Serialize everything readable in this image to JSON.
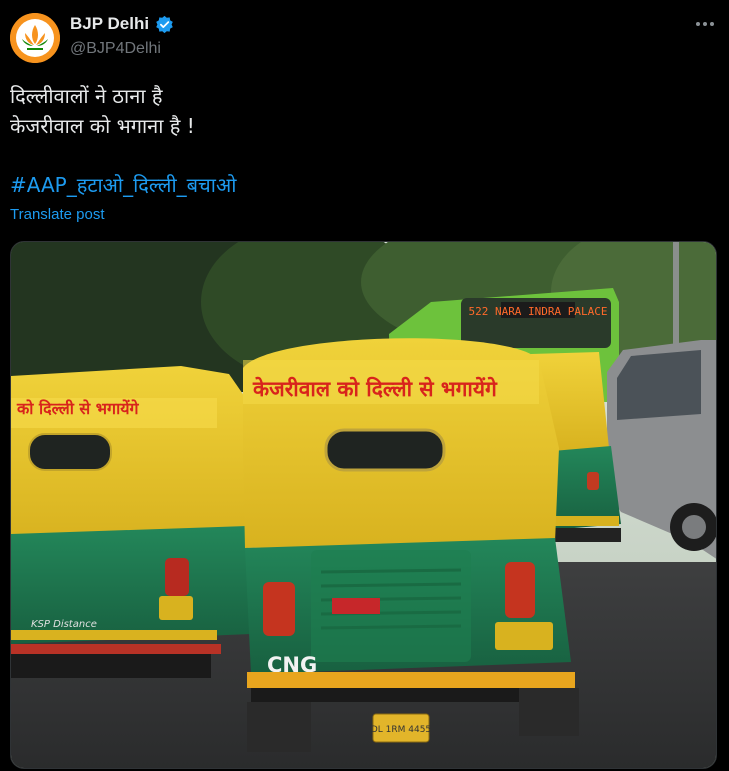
{
  "account": {
    "display_name": "BJP Delhi",
    "handle": "@BJP4Delhi",
    "verified": true,
    "avatar_icon": "lotus-logo-icon",
    "avatar_color": "#f7931e"
  },
  "post": {
    "lines": [
      "दिल्लीवालों ने ठाना है",
      "केजरीवाल को भगाना है !"
    ],
    "hashtag": "#AAP_हटाओ_दिल्ली_बचाओ",
    "translate_label": "Translate post",
    "more_icon": "more-options-icon"
  },
  "photo": {
    "left_auto_text": "को दिल्ली से भगायेंगे",
    "center_auto_text": "केजरीवाल को दिल्ली से भगायेंगे",
    "bus_display": "522 NARA INDRA PALACE",
    "left_auto_plate_text": "KSP Distance",
    "center_badge": "CNG",
    "center_plate": "DL 1RM 4455",
    "accent_colors": {
      "auto_yellow": "#e7c52a",
      "auto_green": "#1f7a4a",
      "bus_green": "#6dc23c",
      "slogan_red": "#d8241c"
    }
  }
}
